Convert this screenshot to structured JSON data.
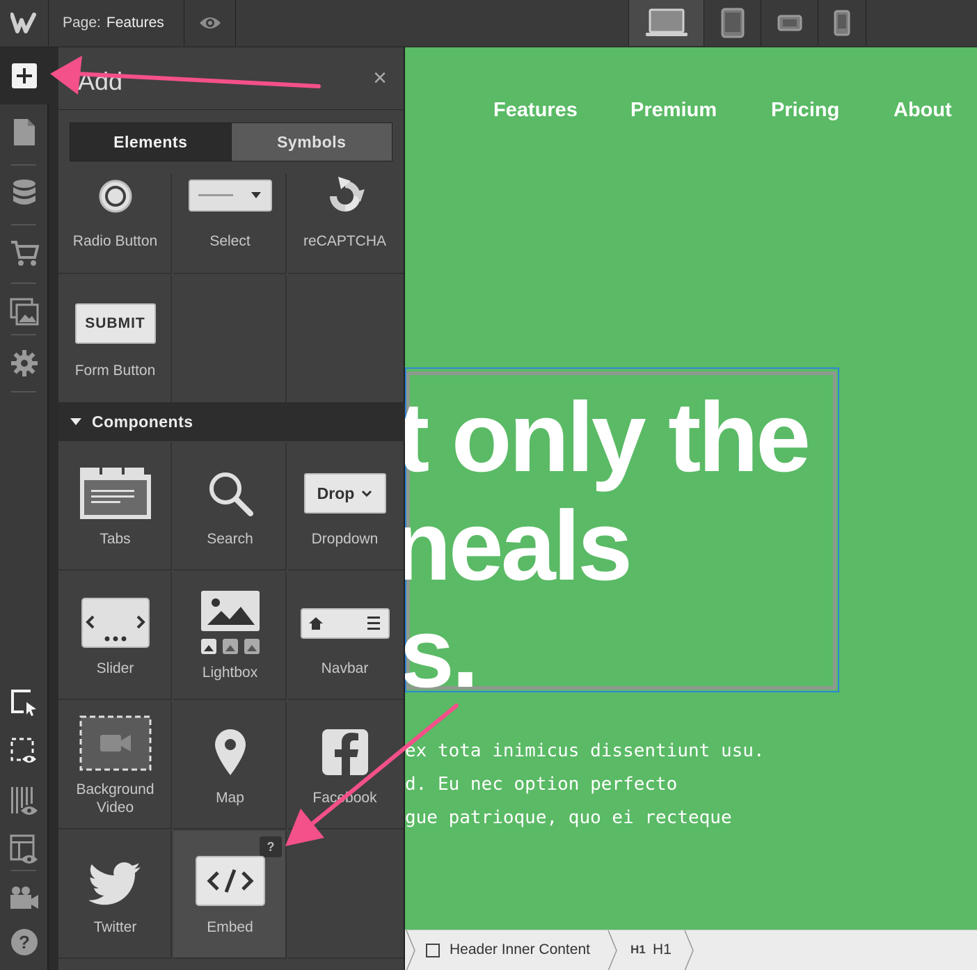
{
  "topbar": {
    "page_prefix": "Page:",
    "page_name": "Features",
    "logo_glyph": "W"
  },
  "panel": {
    "title": "Add",
    "close_glyph": "×",
    "tabs": [
      {
        "label": "Elements",
        "active": true
      },
      {
        "label": "Symbols",
        "active": false
      }
    ],
    "form_items": [
      {
        "label": "Radio Button",
        "icon": "radio-button-icon"
      },
      {
        "label": "Select",
        "icon": "select-icon"
      },
      {
        "label": "reCAPTCHA",
        "icon": "recaptcha-icon"
      },
      {
        "label": "Form Button",
        "icon": "submit-button-icon",
        "button_text": "SUBMIT"
      }
    ],
    "components_heading": "Components",
    "components": [
      {
        "label": "Tabs",
        "icon": "tabs-icon"
      },
      {
        "label": "Search",
        "icon": "search-icon"
      },
      {
        "label": "Dropdown",
        "icon": "dropdown-icon",
        "button_text": "Drop"
      },
      {
        "label": "Slider",
        "icon": "slider-icon"
      },
      {
        "label": "Lightbox",
        "icon": "lightbox-icon"
      },
      {
        "label": "Navbar",
        "icon": "navbar-icon"
      },
      {
        "label": "Background",
        "label2": "Video",
        "icon": "background-video-icon"
      },
      {
        "label": "Map",
        "icon": "map-pin-icon"
      },
      {
        "label": "Facebook",
        "icon": "facebook-icon"
      },
      {
        "label": "Twitter",
        "icon": "twitter-icon"
      },
      {
        "label": "Embed",
        "icon": "embed-code-icon",
        "help": "?"
      }
    ]
  },
  "canvas": {
    "nav": [
      "Features",
      "Premium",
      "Pricing",
      "About"
    ],
    "heading_lines": [
      "t only the",
      "neals",
      "s."
    ],
    "body_lines": [
      " ex tota inimicus dissentiunt usu.",
      "d. Eu nec option perfecto",
      "gue patrioque, quo ei recteque"
    ],
    "bg_color": "#5aba65"
  },
  "breadcrumb": {
    "items": [
      "Header Inner Content",
      "H1"
    ],
    "h1_tag": "H1"
  },
  "colors": {
    "accent_arrow": "#f4508a",
    "selection": "#2f86d6"
  }
}
